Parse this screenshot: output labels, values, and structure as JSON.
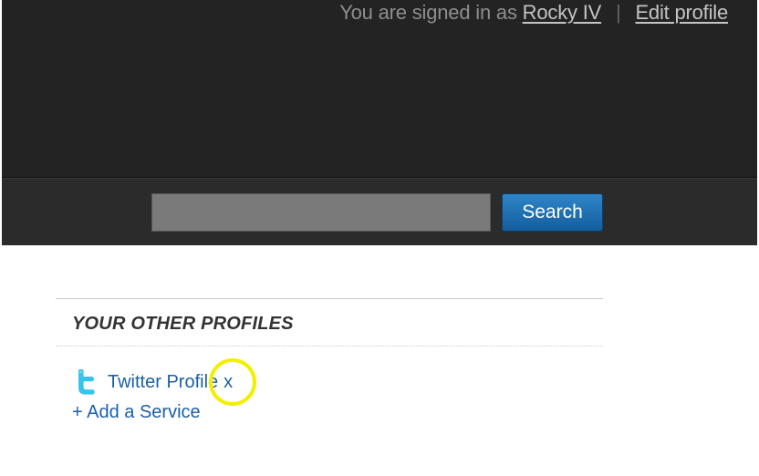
{
  "header": {
    "signed_in_prefix": "You are signed in as",
    "username": "Rocky IV",
    "separator": "|",
    "edit_profile": "Edit profile"
  },
  "search": {
    "value": "",
    "placeholder": "",
    "button_label": "Search"
  },
  "profiles": {
    "title": "YOUR OTHER PROFILES",
    "items": [
      {
        "icon": "twitter-icon",
        "label": "Twitter Profile",
        "remove_label": "x"
      }
    ],
    "add_service_label": "+ Add a Service"
  },
  "colors": {
    "header_bg": "#232323",
    "button_blue": "#1f72b5",
    "link_blue": "#1b5fa6",
    "highlight_yellow": "#f2ef00"
  }
}
